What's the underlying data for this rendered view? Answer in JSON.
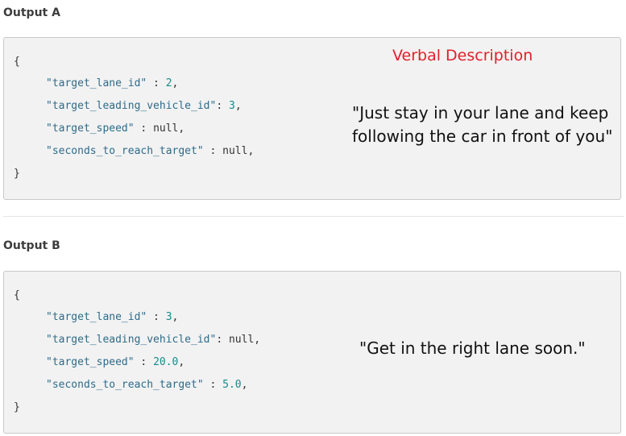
{
  "output_a": {
    "title": "Output A",
    "open_brace": "{",
    "close_brace": "}",
    "lines": [
      {
        "key": "\"target_lane_id\"",
        "sep": " : ",
        "value": "2",
        "value_type": "num"
      },
      {
        "key": "\"target_leading_vehicle_id\"",
        "sep": ": ",
        "value": "3",
        "value_type": "num"
      },
      {
        "key": "\"target_speed\"",
        "sep": " : ",
        "value": "null",
        "value_type": "null"
      },
      {
        "key": "\"seconds_to_reach_target\"",
        "sep": " : ",
        "value": "null",
        "value_type": "null"
      }
    ],
    "verbal_heading": "Verbal Description",
    "verbal_text": "\"Just stay in your lane and keep following the car in front of you\""
  },
  "output_b": {
    "title": "Output B",
    "open_brace": "{",
    "close_brace": "}",
    "lines": [
      {
        "key": "\"target_lane_id\"",
        "sep": " : ",
        "value": "3",
        "value_type": "num"
      },
      {
        "key": "\"target_leading_vehicle_id\"",
        "sep": ": ",
        "value": "null",
        "value_type": "null"
      },
      {
        "key": "\"target_speed\"",
        "sep": " : ",
        "value": "20.0",
        "value_type": "num"
      },
      {
        "key": "\"seconds_to_reach_target\"",
        "sep": " : ",
        "value": "5.0",
        "value_type": "num"
      }
    ],
    "verbal_text": "\"Get in the right lane soon.\""
  },
  "colors": {
    "heading_red": "#e0202a",
    "key_blue": "#2e6b8a",
    "number_teal": "#1a8a8a",
    "code_background": "#f2f2f2"
  }
}
